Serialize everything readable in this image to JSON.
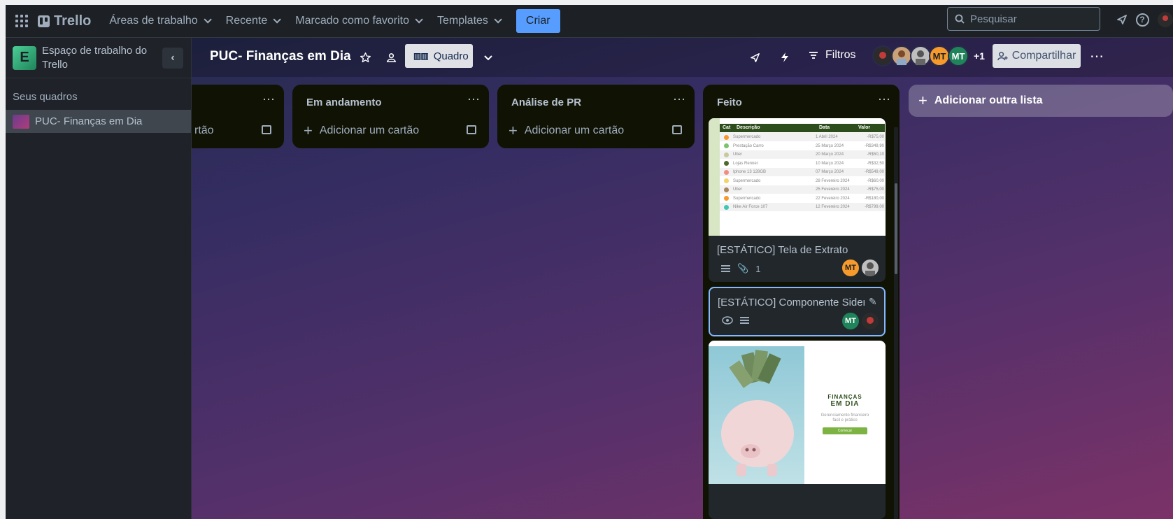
{
  "topbar": {
    "app_name": "Trello",
    "nav": [
      "Áreas de trabalho",
      "Recente",
      "Marcado como favorito",
      "Templates"
    ],
    "create_label": "Criar",
    "search_placeholder": "Pesquisar"
  },
  "sidebar": {
    "workspace_initial": "E",
    "workspace_name": "Espaço de trabalho do Trello",
    "section_title": "Seus quadros",
    "boards": [
      "PUC- Finanças em Dia"
    ]
  },
  "board": {
    "title": "PUC- Finanças em Dia",
    "view_label": "Quadro",
    "filters_label": "Filtros",
    "members": [
      {
        "initials": "",
        "color": "#2b2b2b"
      },
      {
        "initials": "",
        "color": "#c9a27a"
      },
      {
        "initials": "",
        "color": "#bfbfbf"
      },
      {
        "initials": "MT",
        "color": "#f79a2c"
      },
      {
        "initials": "MT",
        "color": "#1f845a"
      }
    ],
    "members_extra": "+1",
    "share_label": "Compartilhar"
  },
  "lists": [
    {
      "title": "",
      "add_card": "Adicionar um cartão",
      "add_card_visible": "rtão"
    },
    {
      "title": "Em andamento",
      "add_card": "Adicionar um cartão"
    },
    {
      "title": "Análise de PR",
      "add_card": "Adicionar um cartão"
    },
    {
      "title": "Feito"
    }
  ],
  "cards": [
    {
      "title": "[ESTÁTICO] Tela de Extrato",
      "attachments": "1",
      "members": [
        "MT",
        ""
      ]
    },
    {
      "title": "[ESTÁTICO] Componente Sideme",
      "members": [
        "MT",
        ""
      ]
    }
  ],
  "extrato_sheet": {
    "headers": [
      "Cat",
      "Descrição",
      "Data",
      "Valor"
    ],
    "rows": [
      {
        "desc": "Supermercado",
        "date": "1 Abril 2024",
        "value": "-R$75,00",
        "color": "#f79a2c"
      },
      {
        "desc": "Prestação Carro",
        "date": "25 Março 2024",
        "value": "-R$349,90",
        "color": "#7cc36f"
      },
      {
        "desc": "Uber",
        "date": "20 Março 2024",
        "value": "-R$50,10",
        "color": "#c9c9a0"
      },
      {
        "desc": "Lojas Renner",
        "date": "10 Março 2024",
        "value": "-R$32,50",
        "color": "#4f6b2a"
      },
      {
        "desc": "Iphone 13 128GB",
        "date": "07 Março 2024",
        "value": "-R$549,00",
        "color": "#f28b82"
      },
      {
        "desc": "Supermercado",
        "date": "28 Fevereiro 2024",
        "value": "-R$60,00",
        "color": "#f5d36b"
      },
      {
        "desc": "Uber",
        "date": "25 Fevereiro 2024",
        "value": "-R$75,00",
        "color": "#a9855b"
      },
      {
        "desc": "Supermercado",
        "date": "22 Fevereiro 2024",
        "value": "-R$180,00",
        "color": "#f79a2c"
      },
      {
        "desc": "Nike Air Force 107",
        "date": "12 Fevereiro 2024",
        "value": "-R$799,00",
        "color": "#3fc7b3"
      }
    ]
  },
  "cover_app": {
    "title_line1": "FINANÇAS",
    "title_line2": "EM DIA",
    "subtitle": "Gerenciamento financeiro fácil e prático",
    "button": "Começar"
  },
  "add_list_label": "Adicionar outra lista"
}
